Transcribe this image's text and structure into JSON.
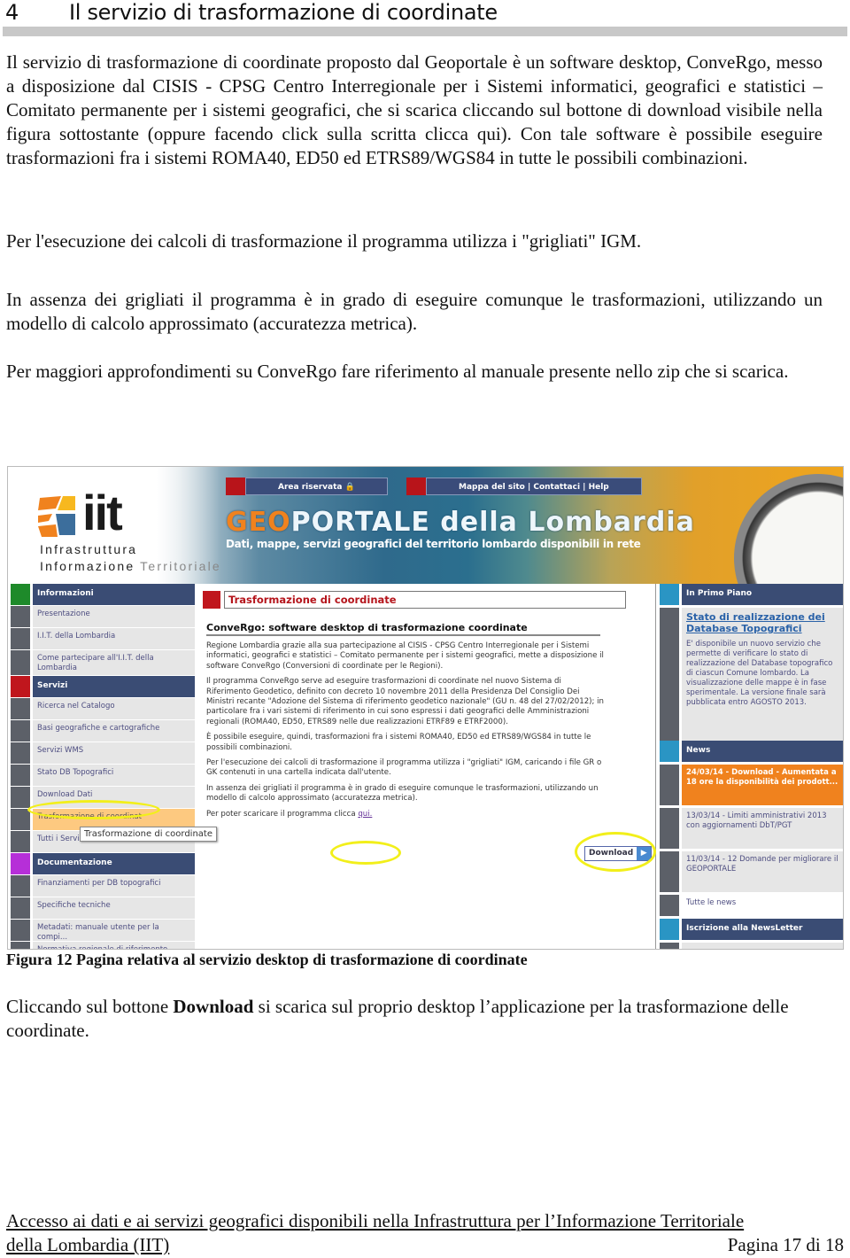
{
  "heading": {
    "number": "4",
    "title": "Il servizio di trasformazione di coordinate"
  },
  "paragraphs": [
    "Il servizio di trasformazione di coordinate proposto dal Geoportale è un software desktop, ConveRgo, messo a disposizione dal CISIS - CPSG Centro Interregionale per i Sistemi informatici, geografici e statistici – Comitato permanente per i sistemi geografici, che si scarica cliccando sul bottone di download visibile nella figura sottostante (oppure facendo click sulla scritta clicca qui). Con tale software è possibile eseguire trasformazioni fra i sistemi ROMA40, ED50 ed ETRS89/WGS84 in tutte le possibili combinazioni.",
    "Per l'esecuzione dei calcoli di trasformazione il programma utilizza i \"grigliati\" IGM.",
    "In assenza dei grigliati il programma è in grado di eseguire comunque le trasformazioni, utilizzando un modello di calcolo approssimato (accuratezza metrica).",
    "Per maggiori approfondimenti su ConveRgo fare riferimento al manuale presente nello zip che si scarica."
  ],
  "figure": {
    "logo": {
      "mark": "iit",
      "line1": "Infrastruttura",
      "line2a": "Informazione ",
      "line2b": "Territoriale"
    },
    "topnav": {
      "reserved": "Area riservata",
      "lock_icon": "🔒",
      "links": "Mappa del sito  |  Contattaci  |  Help"
    },
    "brand": {
      "geo": "GEO",
      "rest": "PORTALE della Lombardia",
      "tagline": "Dati, mappe, servizi geografici del territorio lombardo disponibili in rete"
    },
    "left_menu": [
      {
        "label": "Informazioni",
        "type": "head",
        "color": "#1e8a2a"
      },
      {
        "label": "Presentazione",
        "type": "item"
      },
      {
        "label": "I.I.T. della Lombardia",
        "type": "item"
      },
      {
        "label": "Come partecipare all'I.I.T. della Lombardia",
        "type": "item"
      },
      {
        "label": "Servizi",
        "type": "head",
        "color": "#c0161d"
      },
      {
        "label": "Ricerca nel Catalogo",
        "type": "item"
      },
      {
        "label": "Basi geografiche e cartografiche",
        "type": "item"
      },
      {
        "label": "Servizi WMS",
        "type": "item"
      },
      {
        "label": "Stato DB Topografici",
        "type": "item"
      },
      {
        "label": "Download Dati",
        "type": "item"
      },
      {
        "label": "Trasformazione di coordinat",
        "type": "active"
      },
      {
        "label": "Tutti i Servizi",
        "type": "item"
      },
      {
        "label": "Documentazione",
        "type": "head",
        "color": "#b62fd8"
      },
      {
        "label": "Finanziamenti per DB topografici",
        "type": "item"
      },
      {
        "label": "Specifiche tecniche",
        "type": "item"
      },
      {
        "label": "Metadati: manuale utente per la compi...",
        "type": "item"
      },
      {
        "label": "Normativa regionale di riferimento",
        "type": "item"
      }
    ],
    "tooltip": "Trasformazione di coordinate",
    "center": {
      "title": "Trasformazione di coordinate",
      "subtitle": "ConveRgo: software desktop di trasformazione coordinate",
      "paragraphs": [
        "Regione Lombardia grazie alla sua partecipazione al CISIS - CPSG Centro Interregionale per i Sistemi informatici, geografici e statistici – Comitato permanente per i sistemi geografici, mette a disposizione il software ConveRgo (Conversioni di coordinate per le Regioni).",
        "Il programma ConveRgo serve ad eseguire trasformazioni di coordinate nel nuovo Sistema di Riferimento Geodetico, definito con decreto 10 novembre 2011 della Presidenza Del Consiglio Dei Ministri recante \"Adozione del Sistema di riferimento geodetico nazionale\" (GU n. 48 del 27/02/2012); in particolare fra i vari sistemi di riferimento in cui sono espressi i dati geografici delle Amministrazioni regionali (ROMA40, ED50, ETRS89 nelle due realizzazioni ETRF89 e ETRF2000).",
        "È possibile eseguire, quindi, trasformazioni fra i sistemi ROMA40, ED50 ed ETRS89/WGS84 in tutte le possibili combinazioni.",
        "Per l'esecuzione dei calcoli di trasformazione il programma utilizza i \"grigliati\" IGM, caricando i file GR o GK contenuti in una cartella indicata dall'utente.",
        "In assenza dei grigliati il programma è in grado di eseguire comunque le trasformazioni, utilizzando un modello di calcolo approssimato (accuratezza metrica)."
      ],
      "download_text": "Per poter scaricare il programma clicca ",
      "download_link": "qui.",
      "download_button": "Download",
      "download_arrow": "▶"
    },
    "right": {
      "primo_piano_head": "In Primo Piano",
      "primo_piano_link": "Stato di realizzazione dei Database Topografici",
      "primo_piano_text": "E' disponibile un nuovo servizio che permette di verificare lo stato di realizzazione del Database topografico di ciascun Comune lombardo. La visualizzazione delle mappe è in fase sperimentale. La versione finale sarà pubblicata entro AGOSTO 2013.",
      "news_head": "News",
      "news": [
        "24/03/14 - Download - Aumentata a 18 ore la disponibilità dei prodott...",
        "13/03/14 - Limiti amministrativi 2013 con aggiornamenti DbT/PGT",
        "11/03/14 - 12 Domande per migliorare il GEOPORTALE"
      ],
      "all_news": "Tutte le news",
      "newsletter_head": "Iscrizione alla NewsLetter"
    }
  },
  "caption": "Figura 12 Pagina relativa al servizio desktop di trasformazione di coordinate",
  "after": {
    "before_bold": "Cliccando sul bottone ",
    "bold": "Download",
    "after_bold": " si scarica sul proprio desktop l’applicazione per la trasformazione delle coordinate."
  },
  "footer": {
    "line1": "Accesso ai dati e ai servizi geografici disponibili nella Infrastruttura per l’Informazione Territoriale",
    "line2": "della Lombardia (IIT)",
    "page": "Pagina 17 di 18"
  }
}
